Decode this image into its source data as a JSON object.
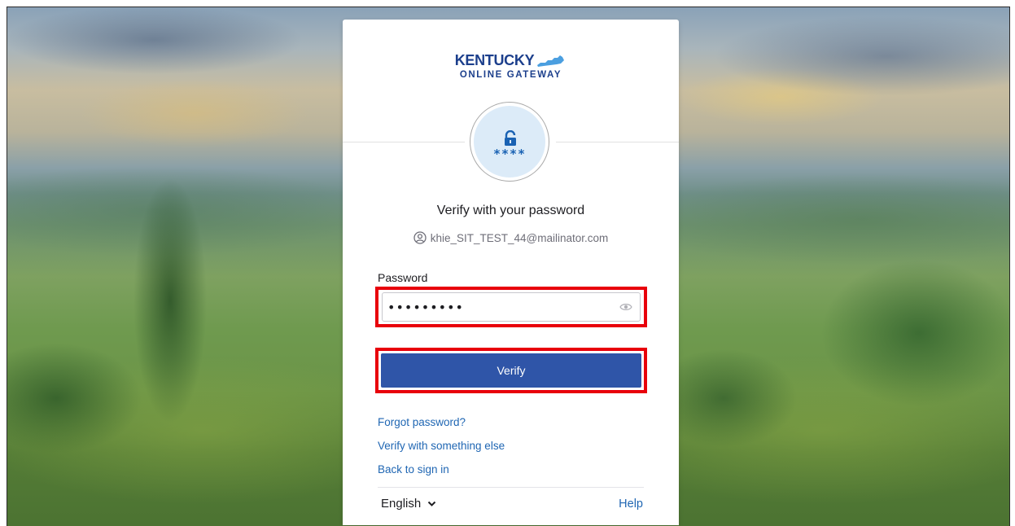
{
  "brand": {
    "line1": "KENTUCKY",
    "line2": "ONLINE GATEWAY",
    "color": "#1c3f8c"
  },
  "badge": {
    "icon": "padlock-icon",
    "stars": "****"
  },
  "form": {
    "title": "Verify with your password",
    "identifier": "khie_SIT_TEST_44@mailinator.com",
    "password_label": "Password",
    "password_value": "•••••••••",
    "verify_label": "Verify"
  },
  "links": {
    "forgot": "Forgot password?",
    "verify_else": "Verify with something else",
    "back": "Back to sign in"
  },
  "footer": {
    "language": "English",
    "help": "Help"
  },
  "colors": {
    "primary_button": "#2f55a8",
    "highlight": "#e8000b",
    "link": "#1f66b3"
  }
}
